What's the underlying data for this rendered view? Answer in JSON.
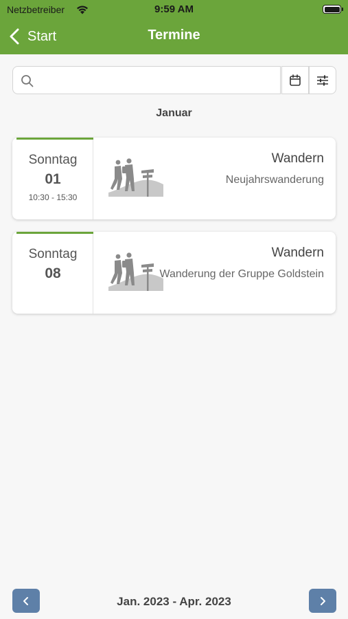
{
  "status_bar": {
    "carrier": "Netzbetreiber",
    "time": "9:59 AM"
  },
  "nav": {
    "back_label": "Start",
    "title": "Termine"
  },
  "search": {
    "placeholder": "",
    "value": ""
  },
  "month_header": "Januar",
  "events": [
    {
      "weekday": "Sonntag",
      "day": "01",
      "time": "10:30 - 15:30",
      "category": "Wandern",
      "title": "Neujahrswanderung",
      "icon": "hikers-icon"
    },
    {
      "weekday": "Sonntag",
      "day": "08",
      "time": "",
      "category": "Wandern",
      "title": "Wanderung der Gruppe Goldstein",
      "icon": "hikers-icon"
    }
  ],
  "footer": {
    "range": "Jan. 2023 - Apr. 2023"
  },
  "colors": {
    "brand_green": "#6ba53b",
    "pager_blue": "#5e80a8",
    "background": "#f7f7f7"
  }
}
